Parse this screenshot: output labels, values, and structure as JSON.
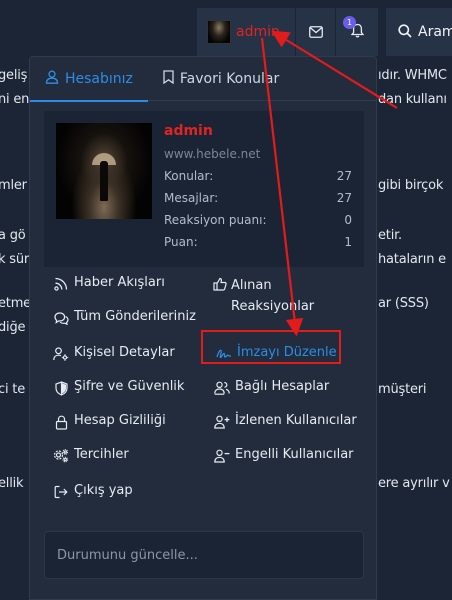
{
  "topbar": {
    "username": "admin",
    "notification_count": "1",
    "search_label": "Aram"
  },
  "background_text": {
    "left": [
      "geliş",
      "ni en",
      "mler",
      "a gö",
      "k sür",
      "etme",
      "diğe",
      "ci te",
      "ellik"
    ],
    "right": [
      "ıdır. WHMC",
      "dan kullanı",
      "gibi birçok",
      "etir.",
      "hataların e",
      "ar (SSS)",
      "müşteri",
      "ere ayrılır v"
    ]
  },
  "tabs": [
    {
      "label": "Hesabınız",
      "active": true
    },
    {
      "label": "Favori Konular",
      "active": false
    }
  ],
  "profile": {
    "name": "admin",
    "site": "www.hebele.net",
    "stats": [
      {
        "label": "Konular:",
        "value": "27"
      },
      {
        "label": "Mesajlar:",
        "value": "27"
      },
      {
        "label": "Reaksiyon puanı:",
        "value": "0"
      },
      {
        "label": "Puan:",
        "value": "1"
      }
    ]
  },
  "menu": {
    "haber": "Haber Akışları",
    "alinan": "Alınan Reaksiyonlar",
    "tum": "Tüm Gönderileriniz",
    "kisisel": "Kişisel Detaylar",
    "imza": "İmzayı Düzenle",
    "sifre": "Şifre ve Güvenlik",
    "bagli": "Bağlı Hesaplar",
    "gizlilik": "Hesap Gizliliği",
    "izlenen": "İzlenen Kullanıcılar",
    "tercihler": "Tercihler",
    "engelli": "Engelli Kullanıcılar",
    "cikis": "Çıkış yap"
  },
  "status_placeholder": "Durumunu güncelle...",
  "colors": {
    "accent": "#2d8de6",
    "username": "#e02424",
    "annotation": "#e31b1b"
  }
}
